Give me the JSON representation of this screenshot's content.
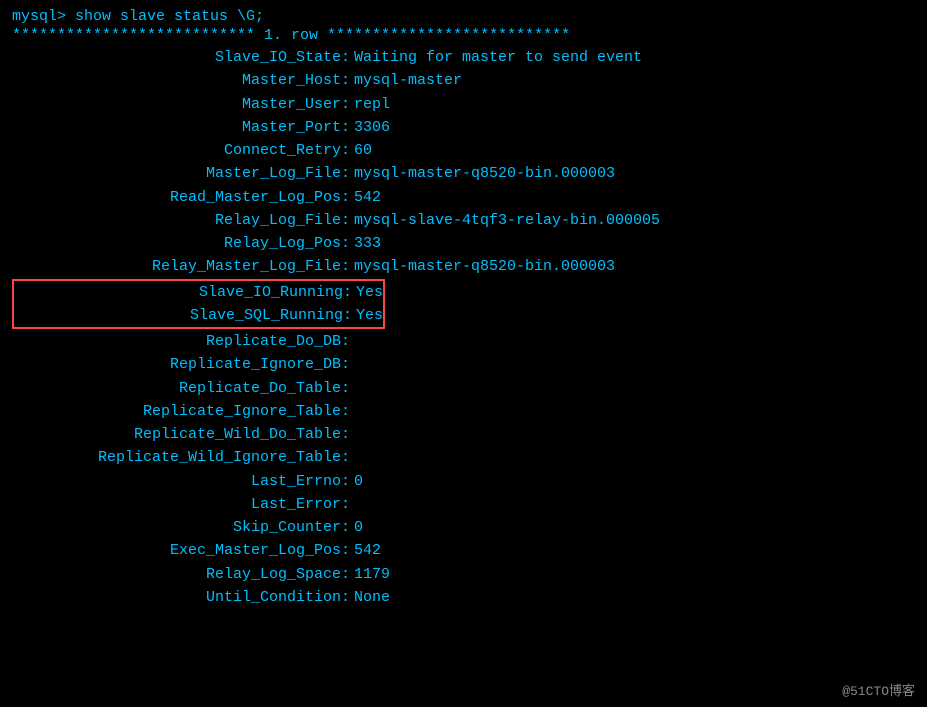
{
  "terminal": {
    "prompt": "mysql> show slave status \\G;",
    "separator": "*************************** 1. row ***************************",
    "fields": [
      {
        "name": "Slave_IO_State:",
        "value": "Waiting for master to send event",
        "highlight": false
      },
      {
        "name": "Master_Host:",
        "value": "mysql-master",
        "highlight": false
      },
      {
        "name": "Master_User:",
        "value": "repl",
        "highlight": false
      },
      {
        "name": "Master_Port:",
        "value": "3306",
        "highlight": false
      },
      {
        "name": "Connect_Retry:",
        "value": "60",
        "highlight": false
      },
      {
        "name": "Master_Log_File:",
        "value": "mysql-master-q8520-bin.000003",
        "highlight": false
      },
      {
        "name": "Read_Master_Log_Pos:",
        "value": "542",
        "highlight": false
      },
      {
        "name": "Relay_Log_File:",
        "value": "mysql-slave-4tqf3-relay-bin.000005",
        "highlight": false
      },
      {
        "name": "Relay_Log_Pos:",
        "value": "333",
        "highlight": false
      },
      {
        "name": "Relay_Master_Log_File:",
        "value": "mysql-master-q8520-bin.000003",
        "highlight": false
      },
      {
        "name": "Slave_IO_Running:",
        "value": "Yes",
        "highlight": true
      },
      {
        "name": "Slave_SQL_Running:",
        "value": "Yes",
        "highlight": true
      },
      {
        "name": "Replicate_Do_DB:",
        "value": "",
        "highlight": false
      },
      {
        "name": "Replicate_Ignore_DB:",
        "value": "",
        "highlight": false
      },
      {
        "name": "Replicate_Do_Table:",
        "value": "",
        "highlight": false
      },
      {
        "name": "Replicate_Ignore_Table:",
        "value": "",
        "highlight": false
      },
      {
        "name": "Replicate_Wild_Do_Table:",
        "value": "",
        "highlight": false
      },
      {
        "name": "Replicate_Wild_Ignore_Table:",
        "value": "",
        "highlight": false
      },
      {
        "name": "Last_Errno:",
        "value": "0",
        "highlight": false
      },
      {
        "name": "Last_Error:",
        "value": "",
        "highlight": false
      },
      {
        "name": "Skip_Counter:",
        "value": "0",
        "highlight": false
      },
      {
        "name": "Exec_Master_Log_Pos:",
        "value": "542",
        "highlight": false
      },
      {
        "name": "Relay_Log_Space:",
        "value": "1179",
        "highlight": false
      },
      {
        "name": "Until_Condition:",
        "value": "None",
        "highlight": false
      }
    ],
    "watermark": "@51CTO博客"
  }
}
